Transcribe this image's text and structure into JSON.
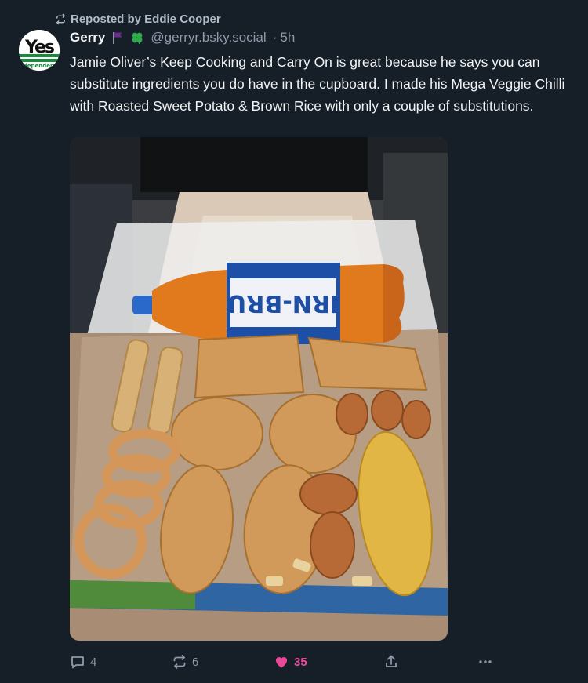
{
  "repost": {
    "text": "Reposted by Eddie Cooper",
    "icon": "repost-icon"
  },
  "author": {
    "display_name": "Gerry",
    "handle": "@gerryr.bsky.social",
    "time": "5h",
    "separator": "·",
    "avatar_text": "Yes",
    "avatar_subtext": "Independence",
    "emoji_icons": [
      "purple-flag-icon",
      "four-leaf-clover-icon"
    ]
  },
  "post": {
    "text": "Jamie Oliver’s Keep Cooking and Carry On is great because he says you can substitute ingredients you do have in the cupboard. I made his Mega Veggie Chilli with Roasted Sweet Potato & Brown Rice with only a couple of substitutions.",
    "image_label": "IRN-BRU"
  },
  "actions": {
    "replies": "4",
    "reposts": "6",
    "likes": "35",
    "liked": true,
    "share_icon": "share-icon",
    "more_icon": "more-options-icon"
  },
  "colors": {
    "background": "#161e27",
    "muted": "#8c9aaa",
    "like_pink": "#ec4899"
  }
}
